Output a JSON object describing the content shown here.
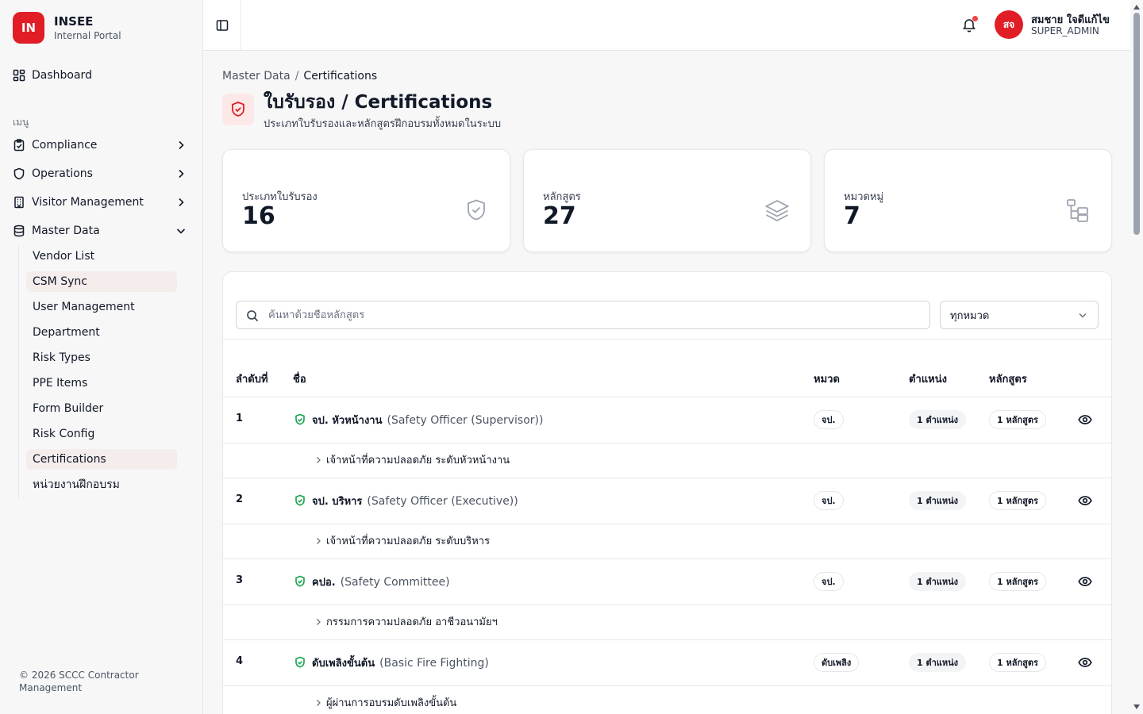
{
  "brand": {
    "logo": "IN",
    "title": "INSEE",
    "subtitle": "Internal Portal"
  },
  "nav": {
    "dashboard": "Dashboard",
    "section": "เมนู",
    "items": [
      {
        "label": "Compliance",
        "icon": "clipboard-check-icon"
      },
      {
        "label": "Operations",
        "icon": "shield-icon"
      },
      {
        "label": "Visitor Management",
        "icon": "building-icon"
      },
      {
        "label": "Master Data",
        "icon": "database-icon"
      }
    ],
    "sub_items": [
      "Vendor List",
      "CSM Sync",
      "User Management",
      "Department",
      "Risk Types",
      "PPE Items",
      "Form Builder",
      "Risk Config",
      "Certifications",
      "หน่วยงานฝึกอบรม"
    ]
  },
  "footer": "© 2026 SCCC Contractor Management",
  "header": {
    "avatar": "สจ",
    "user_name": "สมชาย ใจดีแก้ไข",
    "user_role": "SUPER_ADMIN"
  },
  "breadcrumb": {
    "parent": "Master Data",
    "separator": "/",
    "current": "Certifications"
  },
  "page": {
    "title": "ใบรับรอง / Certifications",
    "subtitle": "ประเภทใบรับรองและหลักสูตรฝึกอบรมทั้งหมดในระบบ"
  },
  "stats": [
    {
      "label": "ประเภทใบรับรอง",
      "value": "16",
      "icon": "shield-check-icon"
    },
    {
      "label": "หลักสูตร",
      "value": "27",
      "icon": "layers-icon"
    },
    {
      "label": "หมวดหมู่",
      "value": "7",
      "icon": "folder-tree-icon"
    }
  ],
  "filters": {
    "search_placeholder": "ค้นหาด้วยชื่อหลักสูตร",
    "category_selected": "ทุกหมวด"
  },
  "table": {
    "headers": {
      "order": "ลำดับที่",
      "name": "ชื่อ",
      "category": "หมวด",
      "position": "ตำแหน่ง",
      "courses": "หลักสูตร"
    },
    "rows": [
      {
        "num": "1",
        "name": "จป. หัวหน้างาน",
        "name_en": "(Safety Officer (Supervisor))",
        "category": "จป.",
        "positions": "1 ตำแหน่ง",
        "courses": "1 หลักสูตร",
        "sub": "เจ้าหน้าที่ความปลอดภัย ระดับหัวหน้างาน"
      },
      {
        "num": "2",
        "name": "จป. บริหาร",
        "name_en": "(Safety Officer (Executive))",
        "category": "จป.",
        "positions": "1 ตำแหน่ง",
        "courses": "1 หลักสูตร",
        "sub": "เจ้าหน้าที่ความปลอดภัย ระดับบริหาร"
      },
      {
        "num": "3",
        "name": "คปอ.",
        "name_en": "(Safety Committee)",
        "category": "จป.",
        "positions": "1 ตำแหน่ง",
        "courses": "1 หลักสูตร",
        "sub": "กรรมการความปลอดภัย อาชีวอนามัยฯ"
      },
      {
        "num": "4",
        "name": "ดับเพลิงขั้นต้น",
        "name_en": "(Basic Fire Fighting)",
        "category": "ดับเพลิง",
        "positions": "1 ตำแหน่ง",
        "courses": "1 หลักสูตร",
        "sub": "ผู้ผ่านการอบรมดับเพลิงขั้นต้น"
      }
    ]
  },
  "colors": {
    "brand_red": "#e11d26",
    "shield_green": "#16a34a",
    "active_bg": "#f5ecec"
  }
}
